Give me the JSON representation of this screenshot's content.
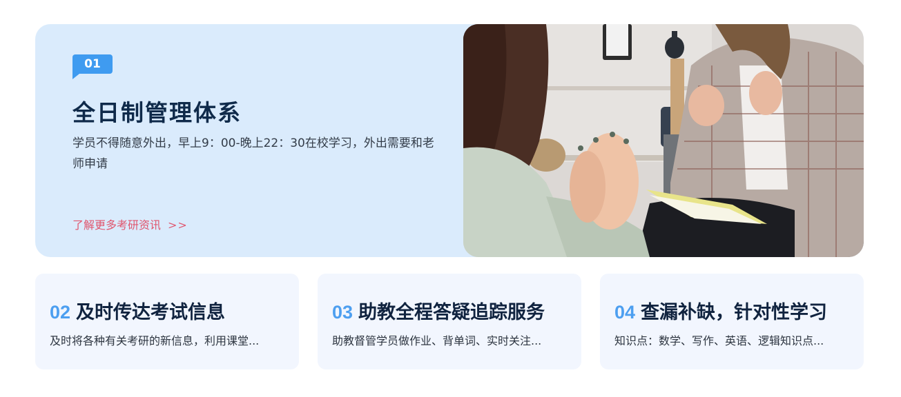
{
  "hero": {
    "badge": "01",
    "title": "全日制管理体系",
    "description": "学员不得随意外出，早上9：00-晚上22：30在校学习，外出需要和老师申请",
    "link_text": "了解更多考研资讯",
    "link_arrows": ">>",
    "image_alt": "two-people-conversation-photo"
  },
  "cards": [
    {
      "number": "02",
      "title": "及时传达考试信息",
      "description": "及时将各种有关考研的新信息，利用课堂..."
    },
    {
      "number": "03",
      "title": "助教全程答疑追踪服务",
      "description": "助教督管学员做作业、背单词、实时关注..."
    },
    {
      "number": "04",
      "title": "查漏补缺，针对性学习",
      "description": "知识点：数学、写作、英语、逻辑知识点..."
    }
  ],
  "colors": {
    "hero_bg": "#daebfc",
    "accent_blue": "#3f9bf0",
    "title_dark": "#0f2a4a",
    "link_red": "#e0566e",
    "card_bg": "#f2f6fe"
  }
}
